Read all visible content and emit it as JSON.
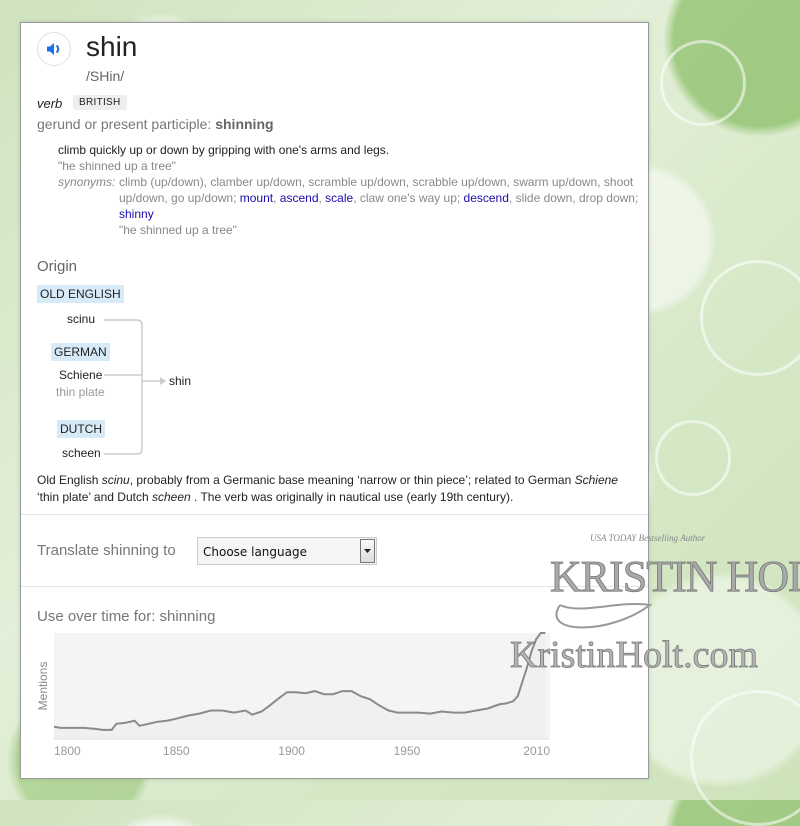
{
  "entry": {
    "word": "shin",
    "pronunciation": "/SHin/",
    "part_of_speech": "verb",
    "region_badge": "BRITISH",
    "gerund_label": "gerund or present participle: ",
    "gerund_value": "shinning",
    "audio_icon": "speaker-icon"
  },
  "sense": {
    "definition": "climb quickly up or down by gripping with one's arms and legs.",
    "example": "\"he shinned up a tree\"",
    "synonyms_label": "synonyms:",
    "synonyms_plain_1": "climb (up/down), clamber up/down, scramble up/down, scrabble up/down, swarm up/down, shoot up/down, go up/down; ",
    "synonym_links": [
      "mount",
      "ascend",
      "scale",
      "descend",
      "shinny"
    ],
    "synonyms_plain_2": ", claw one's way up; ",
    "synonyms_plain_3": ", slide down, drop down; ",
    "synonyms_example": "\"he shinned up a tree\""
  },
  "origin": {
    "heading": "Origin",
    "sources": [
      {
        "language": "OLD ENGLISH",
        "word": "scinu",
        "gloss": ""
      },
      {
        "language": "GERMAN",
        "word": "Schiene",
        "gloss": "thin plate"
      },
      {
        "language": "DUTCH",
        "word": "scheen",
        "gloss": ""
      }
    ],
    "target": "shin",
    "text_1": "Old English ",
    "text_2": "scinu",
    "text_3": ", probably from a Germanic base meaning ‘narrow or thin piece’; related to German ",
    "text_4": "Schiene",
    "text_5": " ‘thin plate’ and Dutch ",
    "text_6": "scheen",
    "text_7": " . The verb was originally in nautical use (early 19th century)."
  },
  "translate": {
    "label": "Translate shinning to",
    "select_value": "Choose language"
  },
  "usage": {
    "label": "Use over time for: shinning"
  },
  "watermark": {
    "tagline": "USA TODAY Bestselling Author",
    "name": "KRISTIN HOLT",
    "site": "KristinHolt.com"
  },
  "chart_data": {
    "type": "area",
    "title": "Use over time for: shinning",
    "xlabel": "",
    "ylabel": "Mentions",
    "xlim": [
      1797,
      2012
    ],
    "ylim": [
      0,
      100
    ],
    "x_ticks": [
      1800,
      1850,
      1900,
      1950,
      2010
    ],
    "grid": false,
    "legend": "none",
    "series": [
      {
        "name": "shinning",
        "x": [
          1797,
          1800,
          1805,
          1810,
          1815,
          1818,
          1822,
          1824,
          1828,
          1832,
          1834,
          1838,
          1842,
          1846,
          1850,
          1855,
          1860,
          1865,
          1870,
          1875,
          1880,
          1883,
          1887,
          1890,
          1895,
          1898,
          1902,
          1906,
          1910,
          1914,
          1918,
          1922,
          1926,
          1930,
          1934,
          1938,
          1942,
          1946,
          1950,
          1955,
          1960,
          1965,
          1970,
          1975,
          1980,
          1985,
          1990,
          1993,
          1996,
          1998,
          2000,
          2002,
          2004,
          2006,
          2008,
          2010
        ],
        "values": [
          8,
          7,
          7,
          7,
          6,
          5,
          5,
          11,
          12,
          14,
          9,
          11,
          13,
          14,
          16,
          19,
          21,
          24,
          24,
          22,
          24,
          20,
          23,
          28,
          37,
          42,
          42,
          41,
          43,
          40,
          40,
          43,
          43,
          38,
          35,
          29,
          24,
          22,
          22,
          22,
          21,
          23,
          22,
          22,
          24,
          26,
          30,
          31,
          33,
          38,
          52,
          66,
          82,
          94,
          100,
          100
        ]
      }
    ]
  }
}
